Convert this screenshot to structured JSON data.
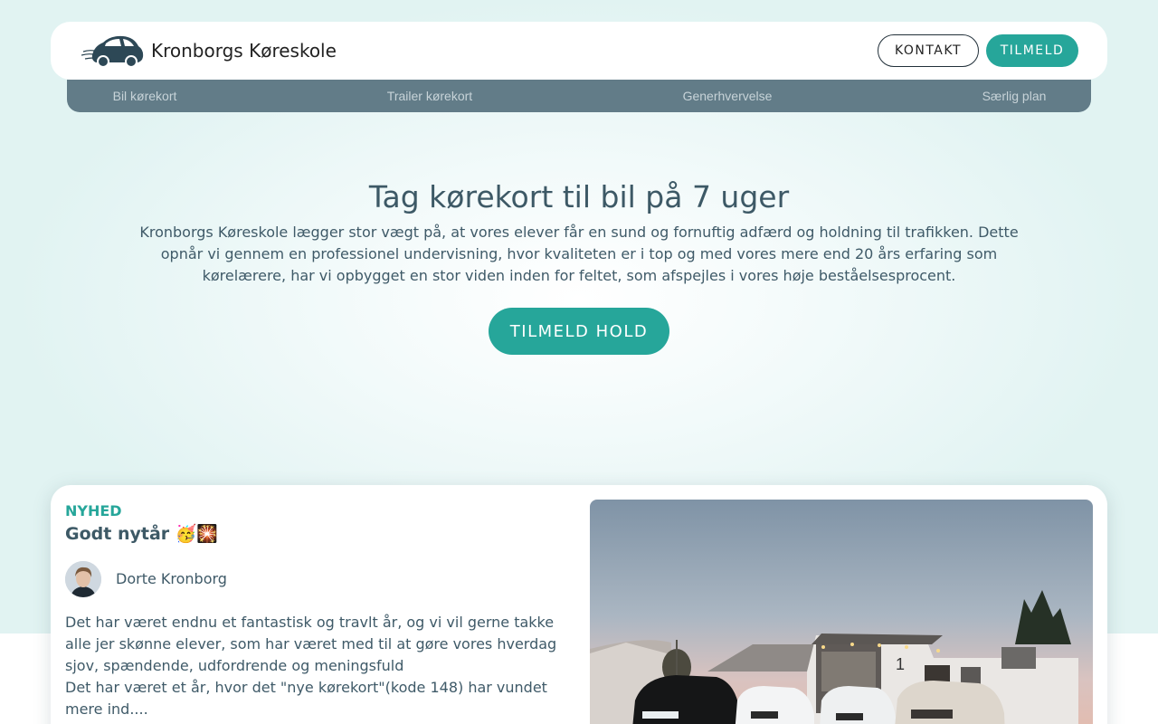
{
  "header": {
    "brand": "Kronborgs Køreskole",
    "contact_label": "KONTAKT",
    "signup_label": "TILMELD"
  },
  "nav": {
    "items": [
      {
        "label": "Bil kørekort"
      },
      {
        "label": "Trailer kørekort"
      },
      {
        "label": "Generhvervelse"
      },
      {
        "label": "Særlig plan"
      }
    ]
  },
  "hero": {
    "title": "Tag kørekort til bil på 7 uger",
    "text": "Kronborgs Køreskole lægger stor vægt på, at vores elever får en sund og fornuftig adfærd og holdning til trafikken. Dette opnår vi gennem en professionel undervisning, hvor kvaliteten er i top og med vores mere end 20 års erfaring som kørelærere, har vi opbygget en stor viden inden for feltet, som afspejles i vores høje beståelsesprocent.",
    "cta_label": "TILMELD HOLD"
  },
  "news": {
    "tag": "NYHED",
    "title": "Godt nytår 🥳🎇",
    "author": "Dorte Kronborg",
    "body_1": "Det har været endnu et fantastisk og travlt år, og vi vil gerne takke alle jer skønne elever, som har været med til at gøre vores hverdag sjov, spændende, udfordrende og meningsfuld",
    "body_2": "Det har været et år, hvor det \"nye kørekort\"(kode 148) har vundet mere ind....",
    "building_number": "1"
  },
  "colors": {
    "accent": "#26a69a",
    "nav_bg": "#627c88",
    "text": "#3f5a68"
  },
  "icons": {
    "logo": "car-logo-icon"
  }
}
